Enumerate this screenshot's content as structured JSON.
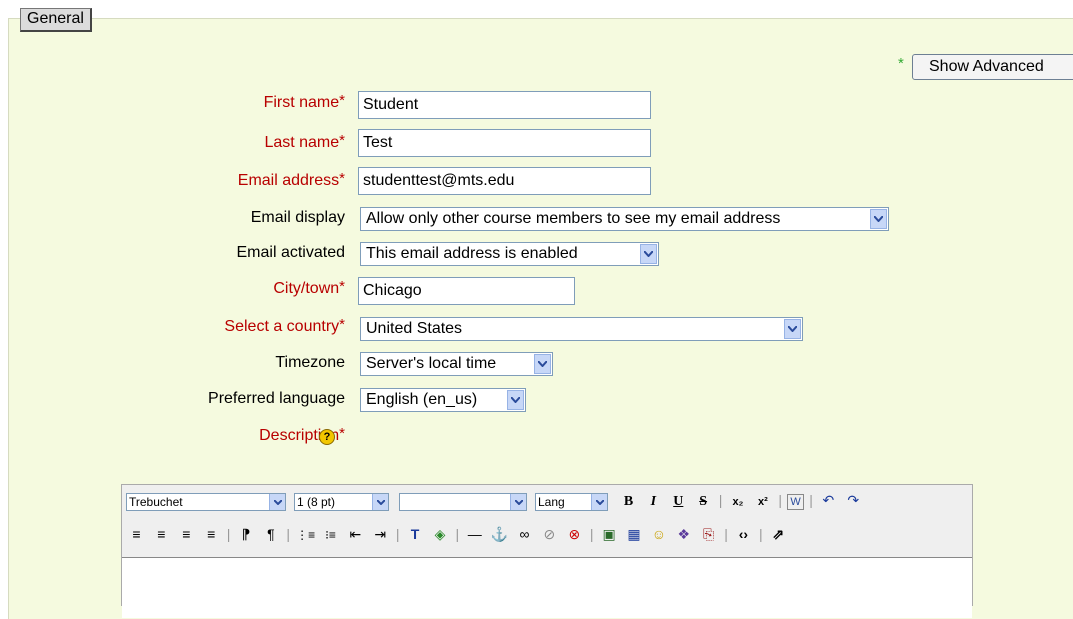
{
  "form": {
    "legend": "General",
    "advanced_star": "*",
    "advanced_button": "Show Advanced",
    "required_star": "*",
    "fields": {
      "first_name": {
        "label": "First name",
        "value": "Student"
      },
      "last_name": {
        "label": "Last name",
        "value": "Test"
      },
      "email": {
        "label": "Email address",
        "value": "studenttest@mts.edu"
      },
      "email_display": {
        "label": "Email display",
        "value": "Allow only other course members to see my email address"
      },
      "email_activated": {
        "label": "Email activated",
        "value": "This email address is enabled"
      },
      "city": {
        "label": "City/town",
        "value": "Chicago"
      },
      "country": {
        "label": "Select a country",
        "value": "United States"
      },
      "timezone": {
        "label": "Timezone",
        "value": "Server's local time"
      },
      "language": {
        "label": "Preferred language",
        "value": "English (en_us)"
      },
      "description": {
        "label": "Description",
        "help": "?"
      }
    }
  },
  "editor": {
    "font": "Trebuchet",
    "size": "1 (8 pt)",
    "style": "",
    "lang": "Lang",
    "row1_icons": [
      "bold-icon",
      "italic-icon",
      "underline-icon",
      "strikethrough-icon",
      "subscript-icon",
      "superscript-icon",
      "clean-word-icon",
      "undo-icon",
      "redo-icon"
    ],
    "row1_glyphs": {
      "bold": "B",
      "italic": "I",
      "underline": "U",
      "strike": "S",
      "sub": "x₂",
      "sup": "x²",
      "word": "W",
      "undo": "↶",
      "redo": "↷"
    },
    "row2_glyphs": {
      "left": "≡",
      "center": "≡",
      "right": "≡",
      "justify": "≡",
      "ltr": "⁋",
      "rtl": "¶",
      "ol": "⋮≡",
      "ul": "⁝≡",
      "outdent": "⇤",
      "indent": "⇥",
      "forecolor": "T",
      "backcolor": "◈",
      "hr": "—",
      "anchor": "⚓",
      "link": "∞",
      "unlink": "⊘",
      "nolink": "⊗",
      "image": "▣",
      "table": "▦",
      "smiley": "☺",
      "special": "❖",
      "search": "⎘",
      "html": "‹›",
      "fullscreen": "⇗"
    }
  }
}
